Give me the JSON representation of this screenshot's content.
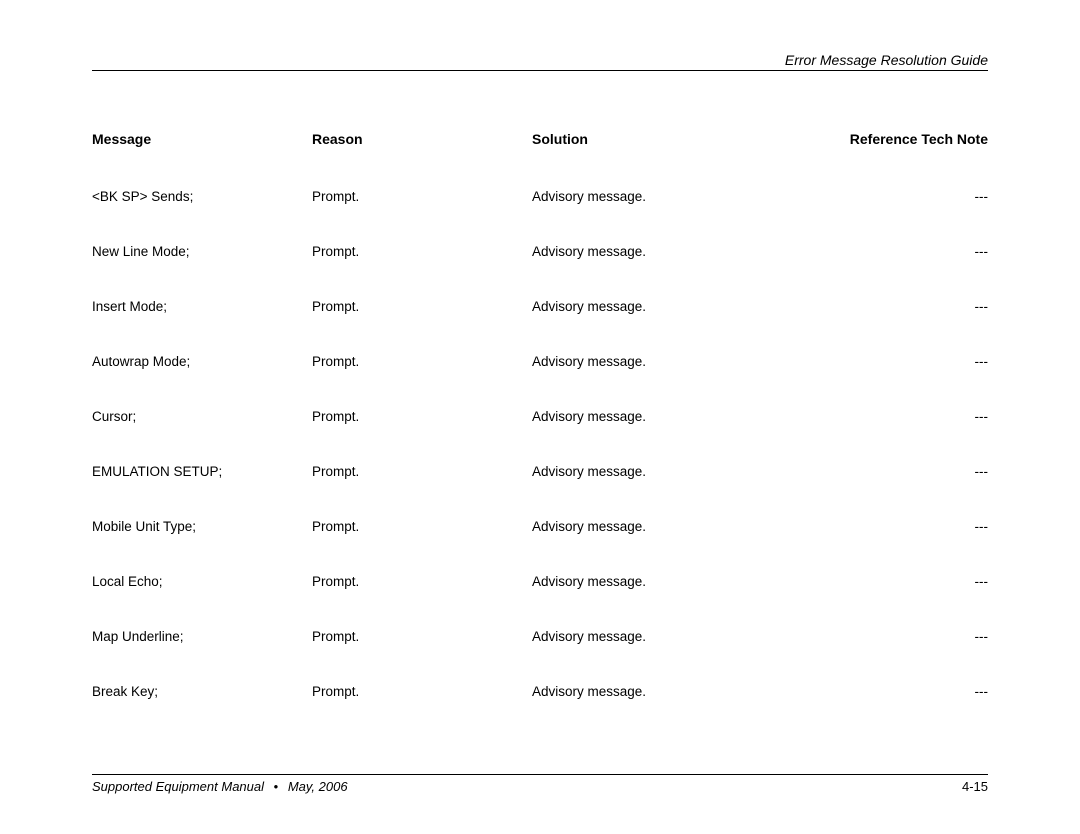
{
  "header": {
    "title": "Error Message Resolution Guide"
  },
  "table": {
    "columns": {
      "message": "Message",
      "reason": "Reason",
      "solution": "Solution",
      "reference": "Reference Tech Note"
    },
    "rows": [
      {
        "message": "<BK SP> Sends;",
        "reason": "Prompt.",
        "solution": "Advisory message.",
        "reference": "---"
      },
      {
        "message": "New Line Mode;",
        "reason": "Prompt.",
        "solution": "Advisory message.",
        "reference": "---"
      },
      {
        "message": "Insert Mode;",
        "reason": "Prompt.",
        "solution": "Advisory message.",
        "reference": "---"
      },
      {
        "message": "Autowrap Mode;",
        "reason": "Prompt.",
        "solution": "Advisory message.",
        "reference": "---"
      },
      {
        "message": "Cursor;",
        "reason": "Prompt.",
        "solution": "Advisory message.",
        "reference": "---"
      },
      {
        "message": "EMULATION SETUP;",
        "reason": "Prompt.",
        "solution": "Advisory message.",
        "reference": "---"
      },
      {
        "message": "Mobile Unit Type;",
        "reason": "Prompt.",
        "solution": "Advisory message.",
        "reference": "---"
      },
      {
        "message": "Local Echo;",
        "reason": "Prompt.",
        "solution": "Advisory message.",
        "reference": "---"
      },
      {
        "message": "Map Underline;",
        "reason": "Prompt.",
        "solution": "Advisory message.",
        "reference": "---"
      },
      {
        "message": "Break Key;",
        "reason": "Prompt.",
        "solution": "Advisory message.",
        "reference": "---"
      }
    ]
  },
  "footer": {
    "manual": "Supported Equipment Manual",
    "bullet": "•",
    "date": "May, 2006",
    "page": "4-15"
  }
}
